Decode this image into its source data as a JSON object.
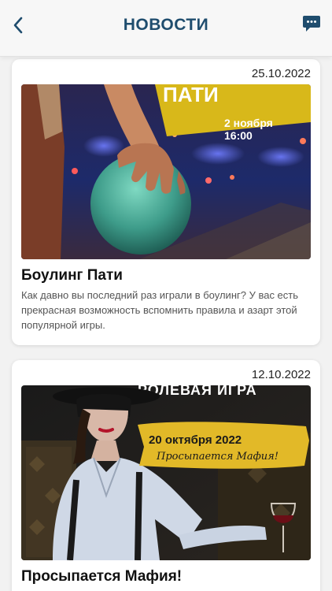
{
  "header": {
    "title": "НОВОСТИ",
    "back_icon": "chevron-left-icon",
    "chat_icon": "chat-bubble-icon",
    "accent_color": "#1f4d6e"
  },
  "news": [
    {
      "date": "25.10.2022",
      "image_text": {
        "banner": "ПАТИ",
        "date_line": "2 ноября",
        "time_line": "16:00"
      },
      "title": "Боулинг Пати",
      "text": "Как давно вы последний раз играли в боулинг? У вас есть прекрасная возможность вспомнить правила и азарт этой популярной игры."
    },
    {
      "date": "12.10.2022",
      "image_text": {
        "banner": "РОЛЕВАЯ ИГРА",
        "date_line": "20 октября 2022",
        "subtitle": "Просыпается Мафия!"
      },
      "title": "Просыпается Мафия!"
    }
  ]
}
